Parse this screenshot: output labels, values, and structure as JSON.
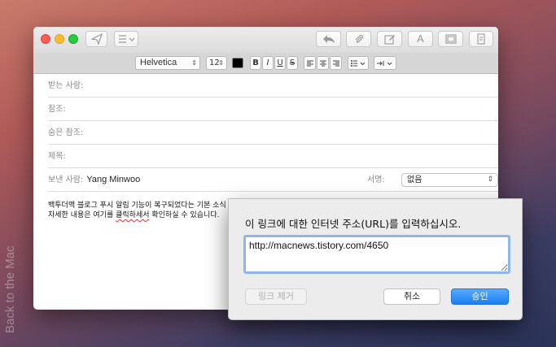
{
  "watermark": "Back to the Mac",
  "toolbar": {
    "send_icon": "paper-plane-icon",
    "header_fields_icon": "list-icon",
    "reply_icon": "reply-arrow-icon",
    "attach_icon": "paperclip-icon",
    "markup_icon": "compose-icon",
    "fonts_label": "A",
    "browser_icon": "window-icon",
    "template_icon": "document-icon"
  },
  "format": {
    "font": "Helvetica",
    "size": "12",
    "bold": "B",
    "italic": "I",
    "underline": "U",
    "strike": "S"
  },
  "fields": {
    "to_label": "받는 사람:",
    "cc_label": "참조:",
    "bcc_label": "숨은 참조:",
    "subject_label": "제목:",
    "from_label": "보낸 사람:",
    "from_value": "Yang Minwoo",
    "signature_label": "서명:",
    "signature_value": "없음"
  },
  "body": {
    "line1_a": "백투더맥 블로그 푸시 알림 기능이 복구되었다는 기본 소식",
    "line2_a": "자세한 내용은 여기를 ",
    "line2_link": "클릭하세서",
    "line2_b": " 확인하실 수 있습니다."
  },
  "dialog": {
    "title": "이 링크에 대한 인터넷 주소(URL)를 입력하십시오.",
    "url_value": "http://macnews.tistory.com/4650",
    "remove_label": "링크 제거",
    "cancel_label": "취소",
    "ok_label": "승인"
  },
  "colors": {
    "accent": "#1a7ff4",
    "close": "#fd5f57",
    "minimize": "#febc2e",
    "maximize": "#28c840"
  }
}
